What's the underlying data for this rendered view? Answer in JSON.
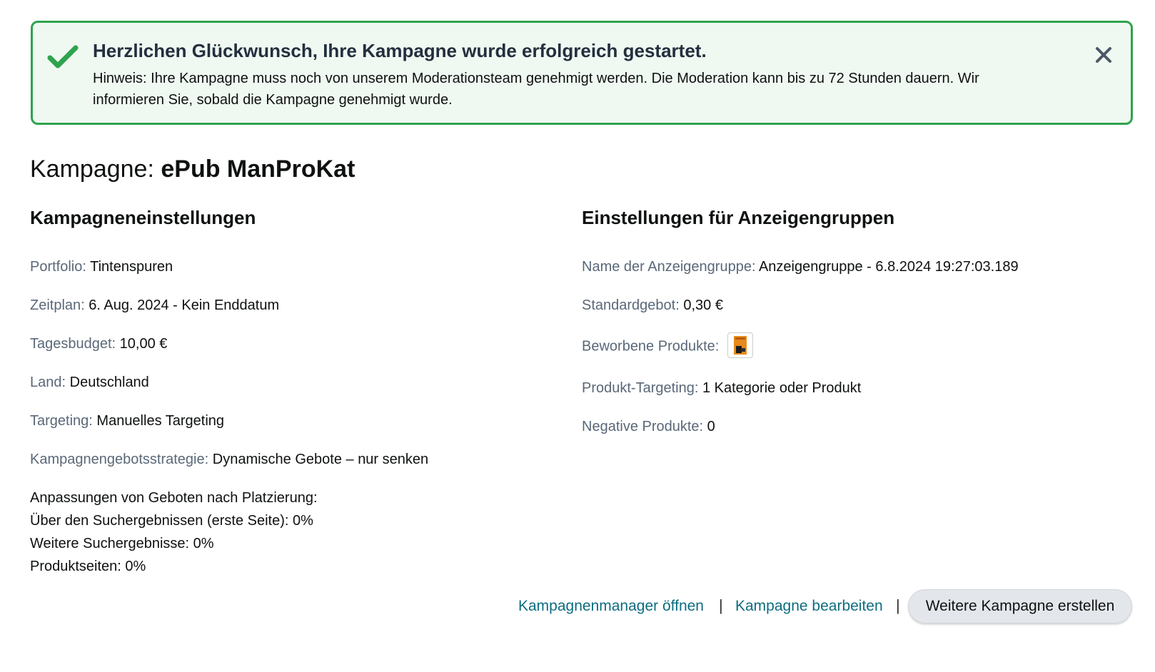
{
  "alert": {
    "title": "Herzlichen Glückwunsch, Ihre Kampagne wurde erfolgreich gestartet.",
    "message": "Hinweis: Ihre Kampagne muss noch von unserem Moderationsteam genehmigt werden. Die Moderation kann bis zu 72 Stunden dauern. Wir informieren Sie, sobald die Kampagne genehmigt wurde.",
    "status_icon": "checkmark-icon",
    "close_icon": "close-icon",
    "accent_color": "#2fa34e"
  },
  "campaign": {
    "title_prefix": "Kampagne:",
    "name": "ePub ManProKat"
  },
  "campaign_settings": {
    "heading": "Kampagneneinstellungen",
    "portfolio": {
      "label": "Portfolio:",
      "value": "Tintenspuren"
    },
    "schedule": {
      "label": "Zeitplan:",
      "value": "6. Aug. 2024 - Kein Enddatum"
    },
    "daily_budget": {
      "label": "Tagesbudget:",
      "value": "10,00 €"
    },
    "country": {
      "label": "Land:",
      "value": "Deutschland"
    },
    "targeting": {
      "label": "Targeting:",
      "value": "Manuelles Targeting"
    },
    "bid_strategy": {
      "label": "Kampagnengebotsstrategie:",
      "value": "Dynamische Gebote – nur senken"
    },
    "placement_adjustments": {
      "label": "Anpassungen von Geboten nach Platzierung:",
      "items": [
        "Über den Suchergebnissen (erste Seite): 0%",
        "Weitere Suchergebnisse: 0%",
        "Produktseiten: 0%"
      ]
    }
  },
  "adgroup_settings": {
    "heading": "Einstellungen für Anzeigengruppen",
    "name": {
      "label": "Name der Anzeigengruppe:",
      "value": "Anzeigengruppe - 6.8.2024 19:27:03.189"
    },
    "default_bid": {
      "label": "Standardgebot:",
      "value": "0,30 €"
    },
    "advertised_products": {
      "label": "Beworbene Produkte:",
      "thumbnail": "book-cover-thumbnail"
    },
    "product_targeting": {
      "label": "Produkt-Targeting:",
      "value": "1 Kategorie oder Produkt"
    },
    "negative_products": {
      "label": "Negative Produkte:",
      "value": "0"
    }
  },
  "footer": {
    "open_manager_link": "Kampagnenmanager öffnen",
    "separator": "|",
    "edit_campaign_link": "Kampagne bearbeiten",
    "create_campaign_button": "Weitere Kampagne erstellen",
    "link_color": "#0e6d80"
  }
}
